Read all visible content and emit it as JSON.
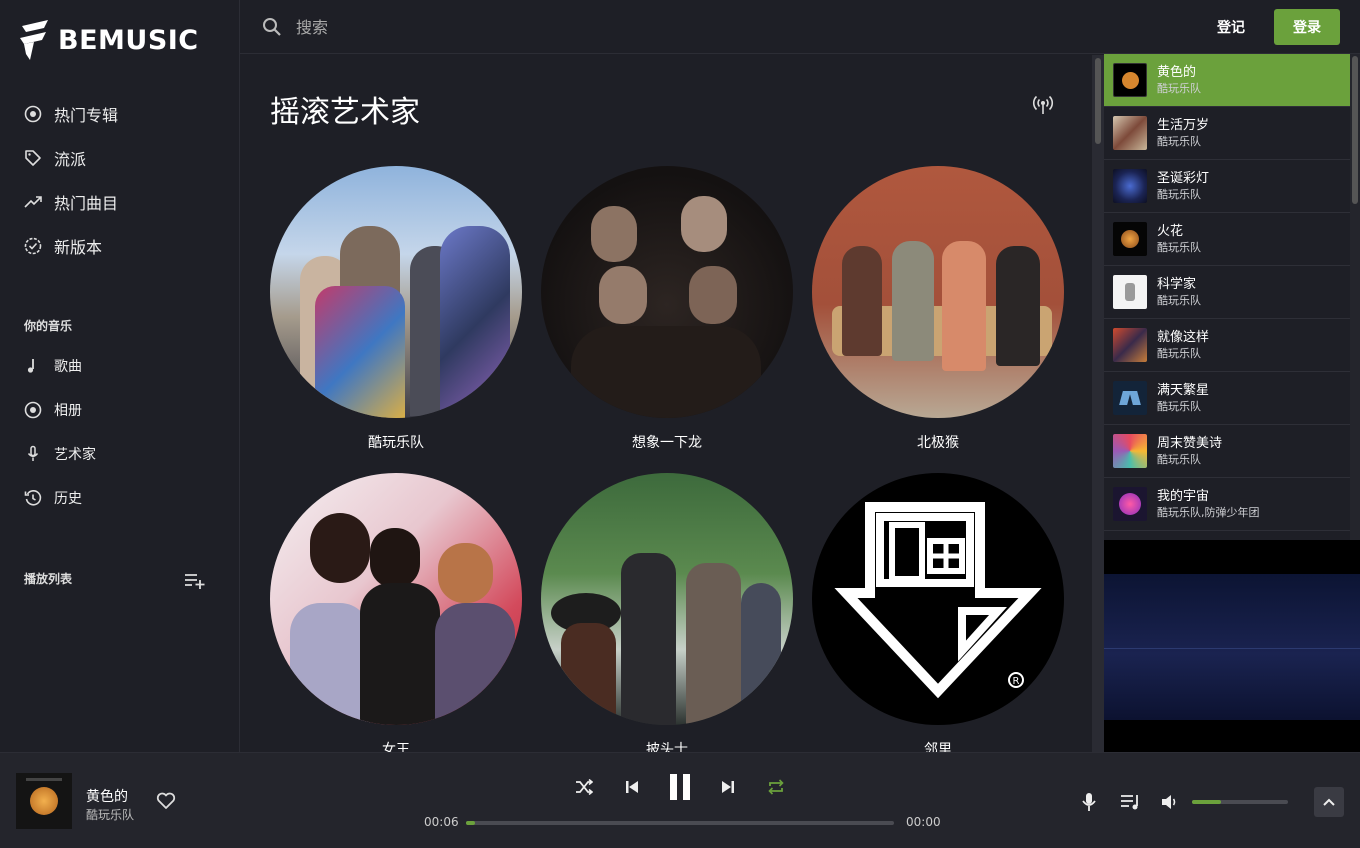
{
  "brand": {
    "name": "BEMUSIC",
    "accent": "#6ba13c"
  },
  "nav": [
    {
      "label": "热门专辑",
      "icon": "disc-icon"
    },
    {
      "label": "流派",
      "icon": "tag-icon"
    },
    {
      "label": "热门曲目",
      "icon": "trending-icon"
    },
    {
      "label": "新版本",
      "icon": "new-release-icon"
    }
  ],
  "your_music": {
    "title": "你的音乐",
    "items": [
      {
        "label": "歌曲",
        "icon": "music-note-icon"
      },
      {
        "label": "相册",
        "icon": "album-icon"
      },
      {
        "label": "艺术家",
        "icon": "microphone-icon"
      },
      {
        "label": "历史",
        "icon": "history-icon"
      }
    ]
  },
  "playlists": {
    "title": "播放列表"
  },
  "search": {
    "placeholder": "搜索"
  },
  "header": {
    "register_label": "登记",
    "login_label": "登录"
  },
  "main": {
    "title": "摇滚艺术家",
    "artists": [
      {
        "name": "酷玩乐队"
      },
      {
        "name": "想象一下龙"
      },
      {
        "name": "北极猴"
      },
      {
        "name": "女王"
      },
      {
        "name": "披头士"
      },
      {
        "name": "邻里"
      }
    ]
  },
  "queue": [
    {
      "title": "黄色的",
      "artist": "酷玩乐队",
      "active": true
    },
    {
      "title": "生活万岁",
      "artist": "酷玩乐队"
    },
    {
      "title": "圣诞彩灯",
      "artist": "酷玩乐队"
    },
    {
      "title": "火花",
      "artist": "酷玩乐队"
    },
    {
      "title": "科学家",
      "artist": "酷玩乐队"
    },
    {
      "title": "就像这样",
      "artist": "酷玩乐队"
    },
    {
      "title": "满天繁星",
      "artist": "酷玩乐队"
    },
    {
      "title": "周末赞美诗",
      "artist": "酷玩乐队"
    },
    {
      "title": "我的宇宙",
      "artist": "酷玩乐队,防弹少年团"
    }
  ],
  "player": {
    "title": "黄色的",
    "artist": "酷玩乐队",
    "elapsed": "00:06",
    "duration": "00:00",
    "progress": 0.02,
    "volume": 0.3
  }
}
